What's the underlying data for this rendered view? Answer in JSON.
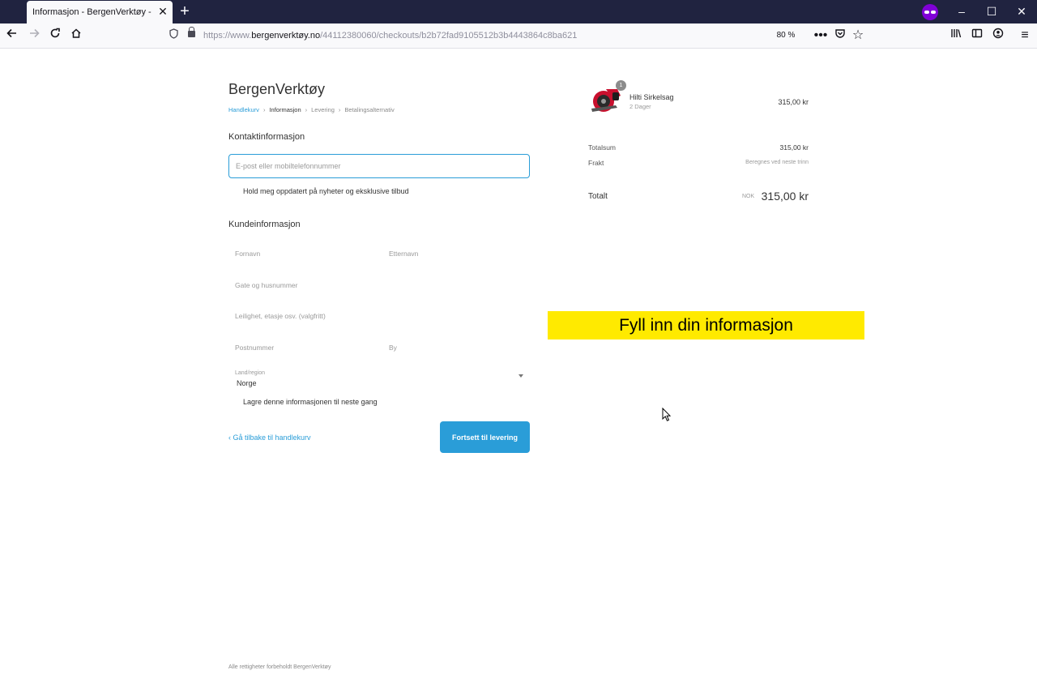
{
  "browser": {
    "tab_title": "Informasjon - BergenVerktøy - Utsjekking",
    "url_prefix": "https://www.",
    "url_host": "bergenverktøy.no",
    "url_path": "/44112380060/checkouts/b2b72fad9105512b3b4443864c8ba621",
    "zoom": "80 %",
    "icons": {
      "back": "arrow-left-icon",
      "forward": "arrow-right-icon",
      "reload": "reload-icon",
      "home": "home-icon",
      "shield": "shield-icon",
      "lock": "lock-icon",
      "more": "more-icon",
      "pocket": "pocket-icon",
      "bookmark": "star-icon",
      "library": "library-icon",
      "sidebar": "sidebar-icon",
      "account": "account-icon",
      "menu": "hamburger-menu-icon",
      "private": "private-browsing-icon"
    }
  },
  "checkout": {
    "brand": "BergenVerktøy",
    "breadcrumb": {
      "cart": "Handlekurv",
      "information": "Informasjon",
      "shipping": "Levering",
      "payment": "Betalingsalternativ"
    },
    "contact": {
      "title": "Kontaktinformasjon",
      "email_placeholder": "E-post eller mobiltelefonnummer",
      "newsletter_label": "Hold meg oppdatert på nyheter og eksklusive tilbud"
    },
    "customer": {
      "title": "Kundeinformasjon",
      "first_name_placeholder": "Fornavn",
      "last_name_placeholder": "Etternavn",
      "address_placeholder": "Gate og husnummer",
      "apartment_placeholder": "Leilighet, etasje osv. (valgfritt)",
      "postal_placeholder": "Postnummer",
      "city_placeholder": "By",
      "country_label": "Land/region",
      "country_value": "Norge",
      "save_label": "Lagre denne informasjonen til neste gang"
    },
    "back_link": "Gå tilbake til handlekurv",
    "continue_button": "Fortsett til levering",
    "footer": "Alle rettigheter forbeholdt BergenVerktøy"
  },
  "summary": {
    "product": {
      "name": "Hilti Sirkelsag",
      "variant": "2 Dager",
      "price": "315,00 kr",
      "quantity": "1"
    },
    "subtotal_label": "Totalsum",
    "subtotal_value": "315,00 kr",
    "shipping_label": "Frakt",
    "shipping_value": "Beregnes ved neste trinn",
    "total_label": "Totalt",
    "total_currency": "NOK",
    "total_value": "315,00 kr"
  },
  "overlay": {
    "caption": "Fyll inn din informasjon"
  },
  "colors": {
    "accent": "#2a9dd8",
    "banner": "#ffea00",
    "browser_frame": "#202340"
  }
}
